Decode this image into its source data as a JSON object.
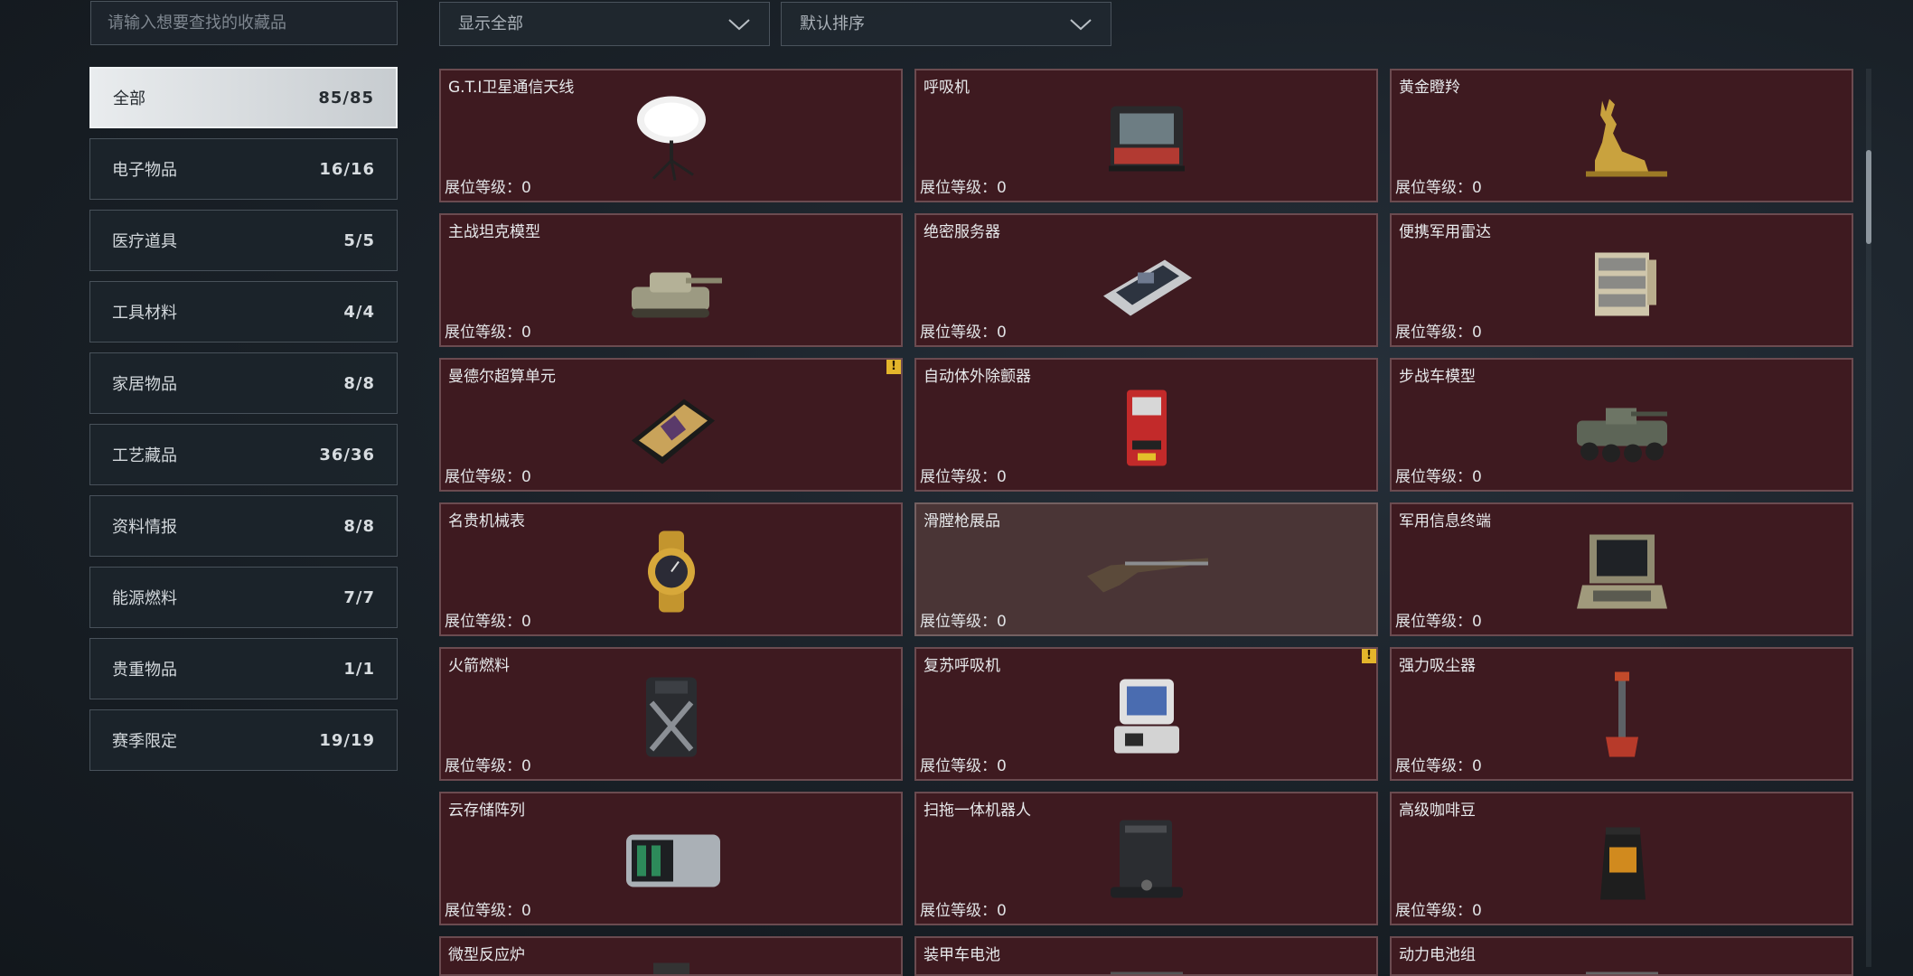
{
  "search": {
    "placeholder": "请输入想要查找的收藏品"
  },
  "filters": {
    "display": "显示全部",
    "sort": "默认排序"
  },
  "sidebar": {
    "items": [
      {
        "label": "全部",
        "count": "85/85",
        "active": true
      },
      {
        "label": "电子物品",
        "count": "16/16"
      },
      {
        "label": "医疗道具",
        "count": "5/5"
      },
      {
        "label": "工具材料",
        "count": "4/4"
      },
      {
        "label": "家居物品",
        "count": "8/8"
      },
      {
        "label": "工艺藏品",
        "count": "36/36"
      },
      {
        "label": "资料情报",
        "count": "8/8"
      },
      {
        "label": "能源燃料",
        "count": "7/7"
      },
      {
        "label": "贵重物品",
        "count": "1/1"
      },
      {
        "label": "赛季限定",
        "count": "19/19"
      }
    ]
  },
  "grid": {
    "level_label": "展位等级：0",
    "items": [
      {
        "name": "G.T.I卫星通信天线",
        "icon": "satellite-dish-icon"
      },
      {
        "name": "呼吸机",
        "icon": "ventilator-icon"
      },
      {
        "name": "黄金瞪羚",
        "icon": "golden-gazelle-icon"
      },
      {
        "name": "主战坦克模型",
        "icon": "tank-model-icon"
      },
      {
        "name": "绝密服务器",
        "icon": "server-icon"
      },
      {
        "name": "便携军用雷达",
        "icon": "radar-icon"
      },
      {
        "name": "曼德尔超算单元",
        "icon": "supercomputer-unit-icon",
        "alert": "!"
      },
      {
        "name": "自动体外除颤器",
        "icon": "defibrillator-icon"
      },
      {
        "name": "步战车模型",
        "icon": "ifv-model-icon"
      },
      {
        "name": "名贵机械表",
        "icon": "watch-icon"
      },
      {
        "name": "滑膛枪展品",
        "icon": "musket-icon",
        "highlight": true
      },
      {
        "name": "军用信息终端",
        "icon": "military-terminal-icon"
      },
      {
        "name": "火箭燃料",
        "icon": "rocket-fuel-icon"
      },
      {
        "name": "复苏呼吸机",
        "icon": "resuscitation-ventilator-icon",
        "alert": "!"
      },
      {
        "name": "强力吸尘器",
        "icon": "vacuum-cleaner-icon"
      },
      {
        "name": "云存储阵列",
        "icon": "storage-array-icon"
      },
      {
        "name": "扫拖一体机器人",
        "icon": "robot-vacuum-icon"
      },
      {
        "name": "高级咖啡豆",
        "icon": "coffee-bean-bag-icon"
      },
      {
        "name": "微型反应炉",
        "icon": "micro-reactor-icon"
      },
      {
        "name": "装甲车电池",
        "icon": "armored-battery-icon"
      },
      {
        "name": "动力电池组",
        "icon": "power-battery-pack-icon"
      }
    ]
  }
}
